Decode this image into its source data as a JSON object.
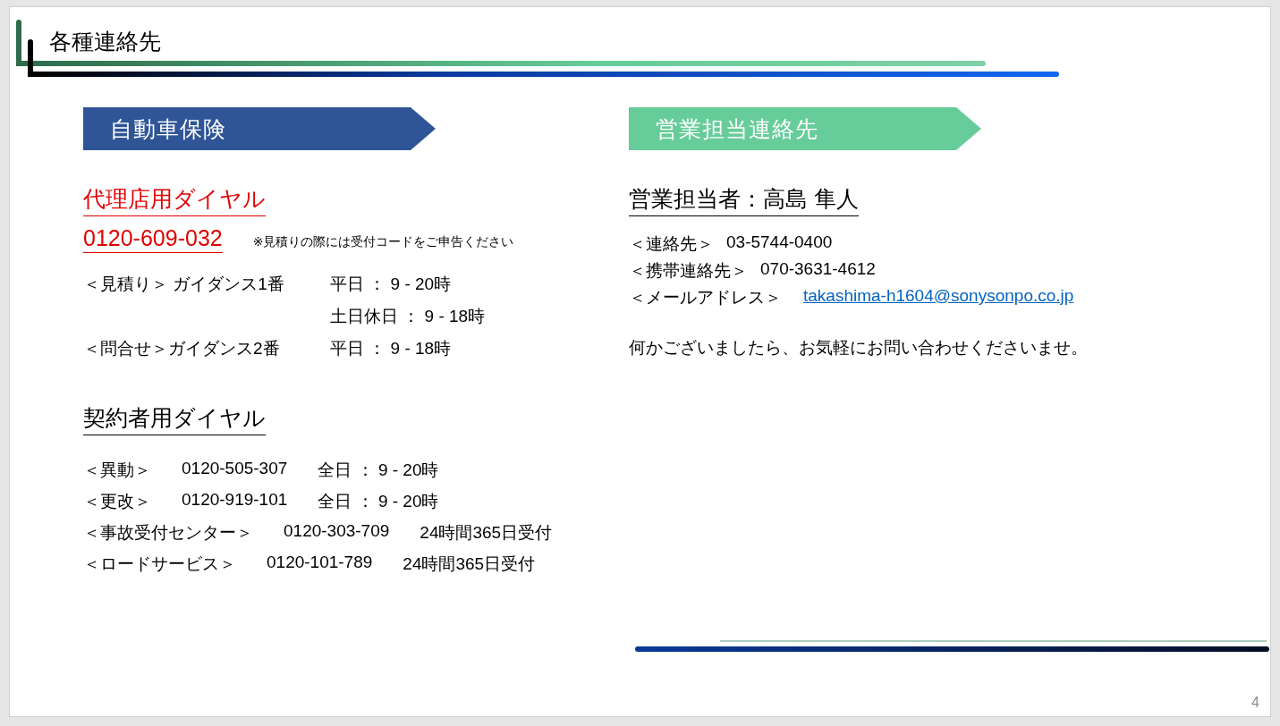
{
  "slide_title": "各種連絡先",
  "banners": [
    {
      "label": "自動車保険",
      "color": "#2f5597"
    },
    {
      "label": "営業担当連絡先",
      "color": "#66cc99"
    }
  ],
  "agency_dial": {
    "heading": "代理店用ダイヤル",
    "phone": "0120-609-032",
    "note": "※見積りの際には受付コードをご申告ください",
    "lines": [
      {
        "label": "＜見積り＞ ガイダンス1番",
        "hours": [
          "平日 ： 9 - 20時",
          "土日休日 ： 9 - 18時"
        ]
      },
      {
        "label": "＜問合せ＞ガイダンス2番",
        "hours": [
          "平日 ： 9 - 18時"
        ]
      }
    ]
  },
  "contract_dial": {
    "heading": "契約者用ダイヤル",
    "lines": [
      {
        "label": "＜異動＞",
        "phone": "0120-505-307",
        "hours": "全日 ： 9 - 20時"
      },
      {
        "label": "＜更改＞",
        "phone": "0120-919-101",
        "hours": "全日 ： 9 - 20時"
      },
      {
        "label": "＜事故受付センター＞",
        "phone": "0120-303-709",
        "hours": "24時間365日受付"
      },
      {
        "label": "＜ロードサービス＞",
        "phone": "0120-101-789",
        "hours": "24時間365日受付"
      }
    ]
  },
  "sales_contact": {
    "heading": "営業担当者：高島 隼人",
    "lines": [
      {
        "kind": "text",
        "label": "＜連絡先＞",
        "value": "03-5744-0400"
      },
      {
        "kind": "text",
        "label": "＜携帯連絡先＞",
        "value": "070-3631-4612"
      },
      {
        "kind": "email",
        "label": "＜メールアドレス＞",
        "value": "takashima-h1604@sonysonpo.co.jp"
      }
    ],
    "message": "何かございましたら、お気軽にお問い合わせくださいませ。"
  },
  "page_number": "4"
}
